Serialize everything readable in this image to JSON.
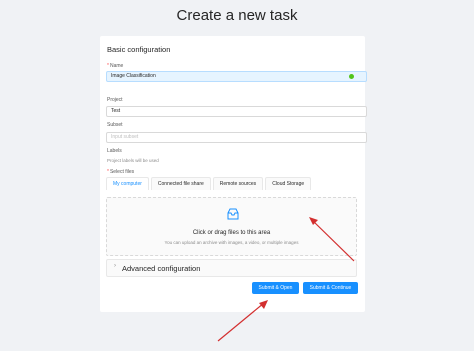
{
  "page": {
    "title": "Create a new task"
  },
  "form": {
    "section_title": "Basic configuration",
    "name": {
      "label": "Name",
      "value": "Image Classification"
    },
    "project": {
      "label": "Project",
      "value": "Test"
    },
    "subset": {
      "label": "Subset",
      "placeholder": "Input subset"
    },
    "labels": {
      "label": "Labels",
      "hint": "Project labels will be used"
    },
    "files": {
      "label": "Select files",
      "tabs": [
        {
          "label": "My computer",
          "active": true
        },
        {
          "label": "Connected file share",
          "active": false
        },
        {
          "label": "Remote sources",
          "active": false
        },
        {
          "label": "Cloud Storage",
          "active": false
        }
      ],
      "dropzone": {
        "icon": "inbox-icon",
        "main_text": "Click or drag files to this area",
        "hint_text": "You can upload an archive with images, a video, or multiple images"
      }
    },
    "advanced": {
      "label": "Advanced configuration",
      "icon": "chevron-right-icon"
    },
    "actions": {
      "submit_open": "Submit & Open",
      "submit_continue": "Submit & Continue"
    }
  },
  "colors": {
    "primary": "#1890ff",
    "required": "#ff4d4f",
    "valid": "#52c41a",
    "annotation_arrow": "#d32f2f"
  }
}
